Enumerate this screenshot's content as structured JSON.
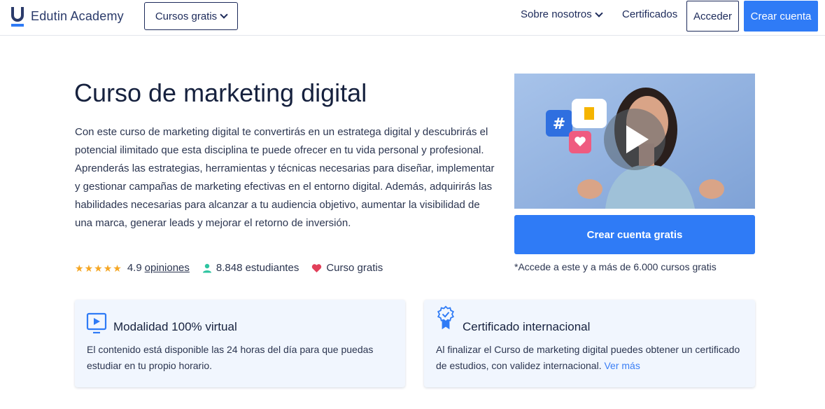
{
  "header": {
    "brand": "Edutin Academy",
    "courses_label": "Cursos gratis",
    "about_label": "Sobre nosotros",
    "certificates_label": "Certificados",
    "login_label": "Acceder",
    "signup_label": "Crear cuenta"
  },
  "hero": {
    "title": "Curso de marketing digital",
    "description": "Con este curso de marketing digital te convertirás en un estratega digital y descubrirás el potencial ilimitado que esta disciplina te puede ofrecer en tu vida personal y profesional. Aprenderás las estrategias, herramientas y técnicas necesarias para diseñar, implementar y gestionar campañas de marketing efectivas en el entorno digital. Además, adquirirás las habilidades necesarias para alcanzar a tu audiencia objetivo, aumentar la visibilidad de una marca, generar leads y mejorar el retorno de inversión.",
    "rating": "4.9",
    "stars": 5,
    "opinions_label": "opiniones",
    "students": "8.848 estudiantes",
    "free_label": "Curso gratis"
  },
  "video": {
    "cta_label": "Crear cuenta gratis",
    "note": "*Accede a este y a más de 6.000 cursos gratis"
  },
  "cards": {
    "modality": {
      "title": "Modalidad 100% virtual",
      "text": "El contenido está disponible las 24 horas del día para que puedas estudiar en tu propio horario."
    },
    "certificate": {
      "title": "Certificado internacional",
      "text": "Al finalizar el Curso de marketing digital puedes obtener un certificado de estudios, con validez internacional.",
      "link": "Ver más"
    }
  },
  "colors": {
    "primary": "#2f7bf6",
    "navy": "#1c2a5a",
    "star": "#f5a623",
    "student_icon": "#2ec4a0",
    "heart": "#e2405a",
    "card_bg": "#f1f6fe"
  },
  "icons": [
    "edutin-logo-icon",
    "chevron-down-icon",
    "star-icon",
    "student-icon",
    "heart-icon",
    "play-icon",
    "monitor-play-icon",
    "certificate-badge-icon"
  ]
}
